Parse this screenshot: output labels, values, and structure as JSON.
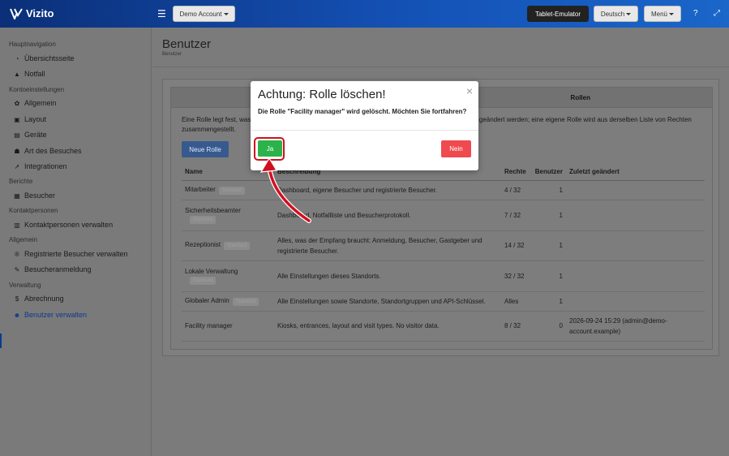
{
  "app": {
    "brand": "Vizito"
  },
  "topbar": {
    "account_label": "Demo Account",
    "tablet_label": "Tablet-Emulator",
    "language_label": "Deutsch",
    "menu_label": "Menü",
    "help_icon": "help-icon",
    "fullscreen_icon": "fullscreen-icon"
  },
  "sidebar": {
    "sections": [
      {
        "title": "Hauptnavigation",
        "items": [
          {
            "label": "Übersichtsseite",
            "icon": "dashboard-icon"
          },
          {
            "label": "Notfall",
            "icon": "warning-icon"
          }
        ]
      },
      {
        "title": "Kontoeinstellungen",
        "items": [
          {
            "label": "Allgemein",
            "icon": "gear-icon"
          },
          {
            "label": "Layout",
            "icon": "image-icon"
          },
          {
            "label": "Geräte",
            "icon": "devices-icon"
          },
          {
            "label": "Art des Besuches",
            "icon": "users-icon"
          },
          {
            "label": "Integrationen",
            "icon": "rocket-icon"
          }
        ]
      },
      {
        "title": "Berichte",
        "items": [
          {
            "label": "Besucher",
            "icon": "report-icon"
          }
        ]
      },
      {
        "title": "Kontaktpersonen",
        "items": [
          {
            "label": "Kontaktpersonen verwalten",
            "icon": "contacts-icon"
          }
        ]
      },
      {
        "title": "Allgemein",
        "items": [
          {
            "label": "Registrierte Besucher verwalten",
            "icon": "registered-icon"
          },
          {
            "label": "Besucheranmeldung",
            "icon": "pencil-icon"
          }
        ]
      },
      {
        "title": "Verwaltung",
        "items": [
          {
            "label": "Abrechnung",
            "icon": "dollar-icon"
          },
          {
            "label": "Benutzer verwalten",
            "icon": "user-cog-icon",
            "active": true
          }
        ]
      }
    ]
  },
  "page": {
    "title": "Benutzer",
    "breadcrumb": "Benutzer",
    "tab_label": "Rollen",
    "description_left": "Eine Rolle legt fest, was",
    "description_right": "nt geändert werden; eine eigene Rolle wird aus derselben Liste von Rechten",
    "description_line2": "zusammengestellt.",
    "new_role_button": "Neue Rolle"
  },
  "table": {
    "headers": {
      "name": "Name",
      "description": "Beschreibung",
      "rights": "Rechte",
      "users": "Benutzer",
      "changed": "Zuletzt geändert"
    },
    "rows": [
      {
        "name": "Mitarbeiter",
        "badge": "Standard",
        "description": "Dashboard, eigene Besucher und registrierte Besucher.",
        "rights": "4 / 32",
        "users": "1",
        "changed": ""
      },
      {
        "name": "Sicherheitsbeamter",
        "badge": "Standard",
        "description": "Dashboard, Notfallliste und Besucherprotokoll.",
        "rights": "7 / 32",
        "users": "1",
        "changed": ""
      },
      {
        "name": "Rezeptionist",
        "badge": "Standard",
        "description": "Alles, was der Empfang braucht: Anmeldung, Besucher, Gastgeber und registrierte Besucher.",
        "rights": "14 / 32",
        "users": "1",
        "changed": ""
      },
      {
        "name": "Lokale Verwaltung",
        "badge": "Standard",
        "description": "Alle Einstellungen dieses Standorts.",
        "rights": "32 / 32",
        "users": "1",
        "changed": ""
      },
      {
        "name": "Globaler Admin",
        "badge": "Standard",
        "description": "Alle Einstellungen sowie Standorte, Standortgruppen und API-Schlüssel.",
        "rights": "Alles",
        "users": "1",
        "changed": ""
      },
      {
        "name": "Facility manager",
        "badge": "",
        "description": "Kiosks, entrances, layout and visit types. No visitor data.",
        "rights": "8 / 32",
        "users": "0",
        "changed": "2026-09-24 15:29 (admin@demo-account.example)"
      }
    ]
  },
  "modal": {
    "title": "Achtung: Rolle löschen!",
    "message": "Die Rolle \"Facility manager\" wird gelöscht. Möchten Sie fortfahren?",
    "confirm_label": "Ja",
    "cancel_label": "Nein",
    "close_glyph": "×"
  },
  "colors": {
    "brand_blue": "#1451b5",
    "confirm_green": "#2bb34a",
    "cancel_red": "#ef4a4f",
    "annotation_red": "#d01020"
  }
}
